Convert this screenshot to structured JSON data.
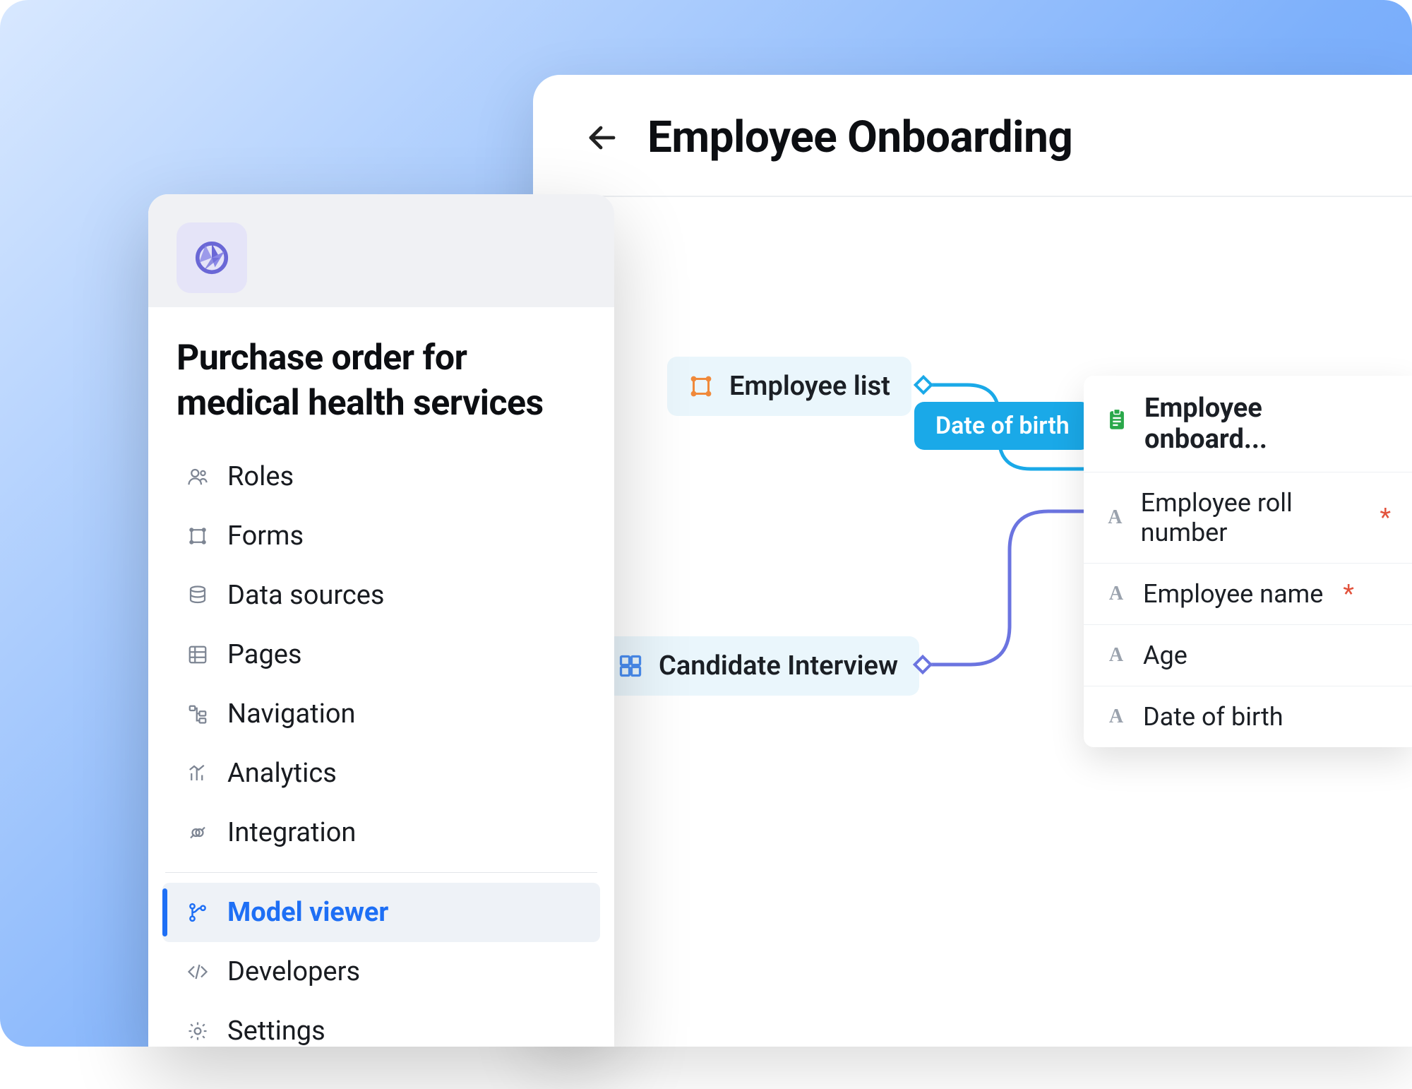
{
  "main": {
    "title": "Employee Onboarding",
    "nodes": {
      "employee_list": {
        "label": "Employee list"
      },
      "candidate_interview": {
        "label": "Candidate Interview"
      }
    },
    "connection_badge": "Date of birth",
    "detail": {
      "title": "Employee onboard...",
      "fields": [
        {
          "label": "Employee roll number",
          "required": true
        },
        {
          "label": "Employee name",
          "required": true
        },
        {
          "label": "Age",
          "required": false
        },
        {
          "label": "Date of birth",
          "required": false
        }
      ]
    }
  },
  "sidebar": {
    "title": "Purchase order for medical health services",
    "items": [
      {
        "key": "roles",
        "label": "Roles",
        "icon": "user"
      },
      {
        "key": "forms",
        "label": "Forms",
        "icon": "form"
      },
      {
        "key": "data-sources",
        "label": "Data sources",
        "icon": "db"
      },
      {
        "key": "pages",
        "label": "Pages",
        "icon": "grid"
      },
      {
        "key": "navigation",
        "label": "Navigation",
        "icon": "tree"
      },
      {
        "key": "analytics",
        "label": "Analytics",
        "icon": "chart"
      },
      {
        "key": "integration",
        "label": "Integration",
        "icon": "plug"
      }
    ],
    "items2": [
      {
        "key": "model-viewer",
        "label": "Model viewer",
        "icon": "branch",
        "active": true
      },
      {
        "key": "developers",
        "label": "Developers",
        "icon": "code"
      },
      {
        "key": "settings",
        "label": "Settings",
        "icon": "gear"
      }
    ]
  },
  "colors": {
    "accent": "#1aa9e8",
    "primary": "#1e6ff5",
    "orange": "#f0893a",
    "green": "#2aa84a",
    "purple": "#6b74e0"
  }
}
